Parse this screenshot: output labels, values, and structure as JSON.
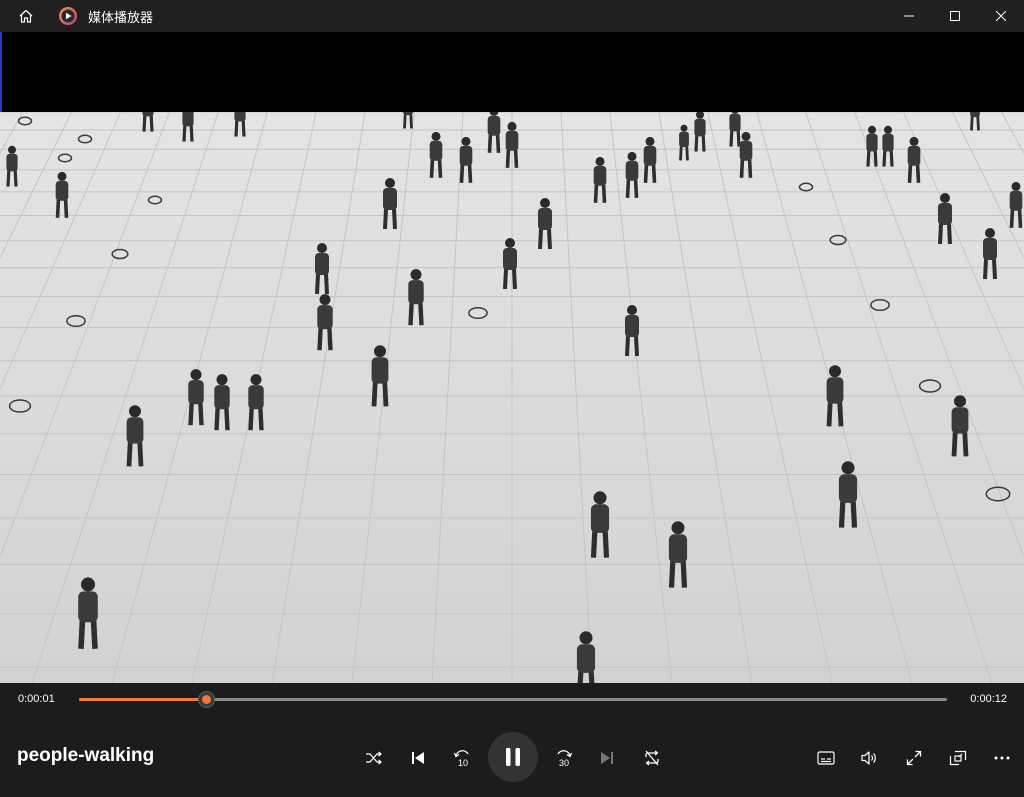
{
  "window": {
    "title": "媒体播放器"
  },
  "icons": {
    "home": "home-icon",
    "app": "media-player-app-icon",
    "minimize": "minimize-icon",
    "maximize": "maximize-icon",
    "close": "close-icon",
    "shuffle": "shuffle-icon",
    "previous": "previous-icon",
    "rewind": "rewind-10-icon",
    "pause": "pause-icon",
    "forward": "forward-30-icon",
    "next": "next-icon",
    "repeat": "repeat-off-icon",
    "subtitles": "subtitles-icon",
    "volume": "volume-icon",
    "fullscreen": "fullscreen-icon",
    "miniplayer": "mini-player-icon",
    "more": "more-icon"
  },
  "player": {
    "current_time": "0:00:01",
    "duration": "0:00:12",
    "progress": 0.146,
    "title": "people-walking",
    "rewind_label": "10",
    "forward_label": "30"
  },
  "colors": {
    "accent": "#f07a3a",
    "background": "#1c1c1c",
    "titlebar": "#202020"
  }
}
